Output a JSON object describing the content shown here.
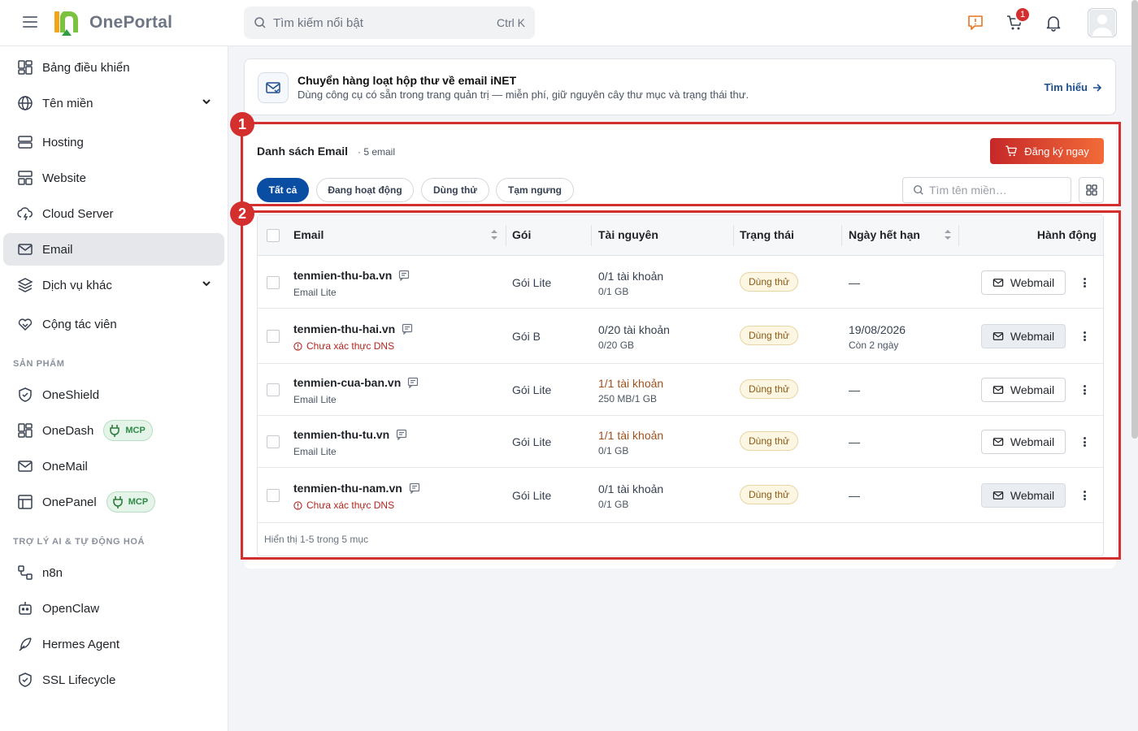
{
  "app": {
    "name": "OnePortal"
  },
  "search": {
    "placeholder": "Tìm kiếm nổi bật",
    "shortcut": "Ctrl K"
  },
  "header": {
    "cart_count": "1"
  },
  "sidebar": {
    "items": [
      {
        "label": "Bảng điều khiển",
        "icon": "dashboard-icon"
      },
      {
        "label": "Tên miền",
        "icon": "globe-icon"
      },
      {
        "label": "Hosting",
        "icon": "server-icon"
      },
      {
        "label": "Website",
        "icon": "website-icon"
      },
      {
        "label": "Cloud Server",
        "icon": "cloud-icon"
      },
      {
        "label": "Email",
        "icon": "mail-icon"
      },
      {
        "label": "Dịch vụ khác",
        "icon": "layers-icon"
      },
      {
        "label": "Cộng tác viên",
        "icon": "handshake-icon"
      }
    ],
    "products_title": "SẢN PHẨM",
    "products": [
      {
        "label": "OneShield",
        "icon": "shield-icon"
      },
      {
        "label": "OneDash",
        "icon": "dashboard-icon",
        "badge": "MCP"
      },
      {
        "label": "OneMail",
        "icon": "mail-icon"
      },
      {
        "label": "OnePanel",
        "icon": "panel-icon",
        "badge": "MCP"
      }
    ],
    "ai_title": "TRỢ LÝ AI & TỰ ĐỘNG HOÁ",
    "ai": [
      {
        "label": "n8n",
        "icon": "workflow-icon"
      },
      {
        "label": "OpenClaw",
        "icon": "robot-icon"
      },
      {
        "label": "Hermes Agent",
        "icon": "feather-icon"
      },
      {
        "label": "SSL Lifecycle",
        "icon": "shield-check-icon"
      }
    ]
  },
  "banner": {
    "title": "Chuyển hàng loạt hộp thư về email iNET",
    "description": "Dùng công cụ có sẵn trong trang quản trị — miễn phí, giữ nguyên cây thư mục và trạng thái thư.",
    "link": "Tìm hiểu"
  },
  "annotations": [
    "1",
    "2"
  ],
  "list": {
    "title": "Danh sách Email",
    "count": "· 5 email",
    "register_button": "Đăng ký ngay",
    "filters": [
      "Tất cả",
      "Đang hoạt động",
      "Dùng thử",
      "Tạm ngưng"
    ],
    "search_placeholder": "Tìm tên miền…"
  },
  "table": {
    "columns": [
      "Email",
      "Gói",
      "Tài nguyên",
      "Trạng thái",
      "Ngày hết hạn",
      "Hành động"
    ],
    "rows": [
      {
        "domain": "tenmien-thu-ba.vn",
        "sub": "Email Lite",
        "sub_warn": false,
        "plan": "Gói Lite",
        "res_main": "0/1 tài khoản",
        "res_warn": false,
        "res_sub": "0/1 GB",
        "status": "Dùng thử",
        "expiry": "—",
        "expiry_sub": "",
        "action": "Webmail",
        "action_soft": false
      },
      {
        "domain": "tenmien-thu-hai.vn",
        "sub": "Chưa xác thực DNS",
        "sub_warn": true,
        "plan": "Gói B",
        "res_main": "0/20 tài khoản",
        "res_warn": false,
        "res_sub": "0/20 GB",
        "status": "Dùng thử",
        "expiry": "19/08/2026",
        "expiry_sub": "Còn 2 ngày",
        "action": "Webmail",
        "action_soft": true
      },
      {
        "domain": "tenmien-cua-ban.vn",
        "sub": "Email Lite",
        "sub_warn": false,
        "plan": "Gói Lite",
        "res_main": "1/1 tài khoản",
        "res_warn": true,
        "res_sub": "250 MB/1 GB",
        "status": "Dùng thử",
        "expiry": "—",
        "expiry_sub": "",
        "action": "Webmail",
        "action_soft": false
      },
      {
        "domain": "tenmien-thu-tu.vn",
        "sub": "Email Lite",
        "sub_warn": false,
        "plan": "Gói Lite",
        "res_main": "1/1 tài khoản",
        "res_warn": true,
        "res_sub": "0/1 GB",
        "status": "Dùng thử",
        "expiry": "—",
        "expiry_sub": "",
        "action": "Webmail",
        "action_soft": false
      },
      {
        "domain": "tenmien-thu-nam.vn",
        "sub": "Chưa xác thực DNS",
        "sub_warn": true,
        "plan": "Gói Lite",
        "res_main": "0/1 tài khoản",
        "res_warn": false,
        "res_sub": "0/1 GB",
        "status": "Dùng thử",
        "expiry": "—",
        "expiry_sub": "",
        "action": "Webmail",
        "action_soft": true
      }
    ],
    "footer": "Hiển thị 1-5 trong 5 mục"
  },
  "colors": {
    "brand_blue": "#0a4ea3",
    "accent_red": "#d32f2f",
    "active_nav": "#e5e7ea"
  }
}
